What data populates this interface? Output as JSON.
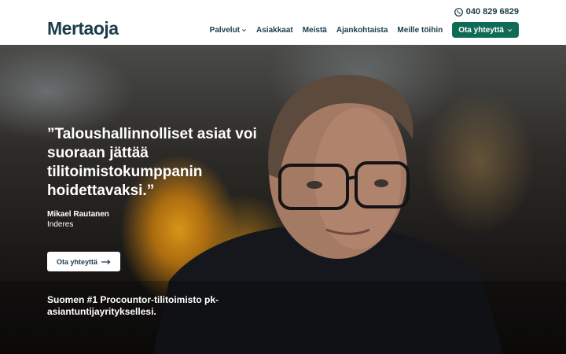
{
  "header": {
    "logo": "Mertaoja",
    "phone": "040 829 6829",
    "nav": [
      {
        "label": "Palvelut",
        "has_dropdown": true
      },
      {
        "label": "Asiakkaat"
      },
      {
        "label": "Meistä"
      },
      {
        "label": "Ajankohtaista"
      },
      {
        "label": "Meille töihin"
      }
    ],
    "cta_label": "Ota yhteyttä"
  },
  "hero": {
    "quote": "”Taloushallinnolliset asiat voi suoraan jättää tilitoimistokumppanin hoidettavaksi.”",
    "author": "Mikael Rautanen",
    "company": "Inderes",
    "button_label": "Ota yhteyttä",
    "tagline": "Suomen #1 Procountor-tilitoimisto pk-asiantuntijayrityksellesi."
  },
  "colors": {
    "brand_dark": "#1c3b4b",
    "cta_green": "#0f6b56"
  },
  "icons": {
    "phone": "phone-icon",
    "dropdown": "chevron-down-icon",
    "arrow": "arrow-right-icon"
  }
}
